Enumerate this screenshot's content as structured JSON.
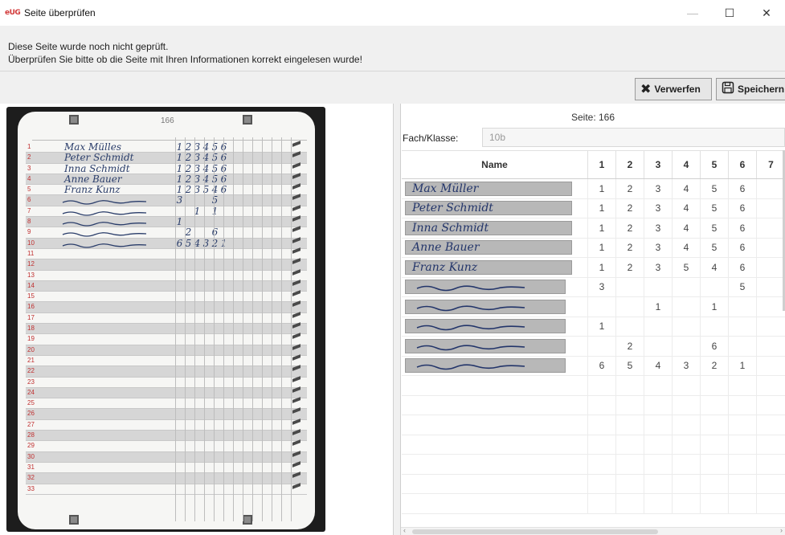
{
  "window": {
    "logo_text": "eUG",
    "title": "Seite überprüfen",
    "minimize": "—",
    "maximize": "☐",
    "close": "✕"
  },
  "info": {
    "line1": "Diese Seite wurde noch nicht geprüft.",
    "line2": "Überprüfen Sie bitte ob die Seite mit Ihren Informationen korrekt eingelesen wurde!"
  },
  "toolbar": {
    "discard_label": "Verwerfen",
    "save_label": "Speichern"
  },
  "scan": {
    "page_number": "166",
    "rows": [
      {
        "num": "1",
        "name": "Max  Mülles",
        "vals": [
          "1",
          "2",
          "3",
          "4",
          "5",
          "6"
        ]
      },
      {
        "num": "2",
        "name": "Peter  Schmidt",
        "vals": [
          "1",
          "2",
          "3",
          "4",
          "5",
          "6"
        ]
      },
      {
        "num": "3",
        "name": "Inna  Schmidt",
        "vals": [
          "1",
          "2",
          "3",
          "4",
          "5",
          "6"
        ]
      },
      {
        "num": "4",
        "name": "Anne  Bauer",
        "vals": [
          "1",
          "2",
          "3",
          "4",
          "5",
          "6"
        ]
      },
      {
        "num": "5",
        "name": "Franz  Kunz",
        "vals": [
          "1",
          "2",
          "3",
          "5",
          "4",
          "6"
        ]
      },
      {
        "num": "6",
        "name": "",
        "vals": [
          "3",
          "",
          "",
          "",
          "5",
          ""
        ]
      },
      {
        "num": "7",
        "name": "",
        "vals": [
          "",
          "",
          "1",
          "",
          "1",
          ""
        ]
      },
      {
        "num": "8",
        "name": "",
        "vals": [
          "1",
          "",
          "",
          "",
          "",
          ""
        ]
      },
      {
        "num": "9",
        "name": "",
        "vals": [
          "",
          "2",
          "",
          "",
          "6",
          ""
        ]
      },
      {
        "num": "10",
        "name": "",
        "vals": [
          "6",
          "5",
          "4",
          "3",
          "2",
          "1"
        ]
      },
      {
        "num": "11"
      },
      {
        "num": "12"
      },
      {
        "num": "13"
      },
      {
        "num": "14"
      },
      {
        "num": "15"
      },
      {
        "num": "16"
      },
      {
        "num": "17"
      },
      {
        "num": "18"
      },
      {
        "num": "19"
      },
      {
        "num": "20"
      },
      {
        "num": "21"
      },
      {
        "num": "22"
      },
      {
        "num": "23"
      },
      {
        "num": "24"
      },
      {
        "num": "25"
      },
      {
        "num": "26"
      },
      {
        "num": "27"
      },
      {
        "num": "28"
      },
      {
        "num": "29"
      },
      {
        "num": "30"
      },
      {
        "num": "31"
      },
      {
        "num": "32"
      },
      {
        "num": "33"
      }
    ]
  },
  "review": {
    "page_label": "Seite: 166",
    "class_label": "Fach/Klasse:",
    "class_value": "10b",
    "columns": [
      "Name",
      "1",
      "2",
      "3",
      "4",
      "5",
      "6",
      "7"
    ],
    "rows": [
      {
        "name": "Max  Müller",
        "vals": [
          "1",
          "2",
          "3",
          "4",
          "5",
          "6",
          ""
        ]
      },
      {
        "name": "Peter  Schmidt",
        "vals": [
          "1",
          "2",
          "3",
          "4",
          "5",
          "6",
          ""
        ]
      },
      {
        "name": "Inna  Schmidt",
        "vals": [
          "1",
          "2",
          "3",
          "4",
          "5",
          "6",
          ""
        ]
      },
      {
        "name": "Anne  Bauer",
        "vals": [
          "1",
          "2",
          "3",
          "4",
          "5",
          "6",
          ""
        ]
      },
      {
        "name": "Franz  Kunz",
        "vals": [
          "1",
          "2",
          "3",
          "5",
          "4",
          "6",
          ""
        ]
      },
      {
        "name": "",
        "vals": [
          "3",
          "",
          "",
          "",
          "",
          "5",
          ""
        ]
      },
      {
        "name": "",
        "vals": [
          "",
          "",
          "1",
          "",
          "1",
          "",
          ""
        ]
      },
      {
        "name": "",
        "vals": [
          "1",
          "",
          "",
          "",
          "",
          "",
          ""
        ]
      },
      {
        "name": "",
        "vals": [
          "",
          "2",
          "",
          "",
          "6",
          "",
          ""
        ]
      },
      {
        "name": "",
        "vals": [
          "6",
          "5",
          "4",
          "3",
          "2",
          "1",
          ""
        ]
      }
    ],
    "empty_rows": 7
  },
  "icons": {
    "discard": "x-icon",
    "save": "floppy-disk-icon"
  },
  "colors": {
    "row_number": "#c03030",
    "ink": "#2a3d6a",
    "logo": "#d23a3a"
  }
}
